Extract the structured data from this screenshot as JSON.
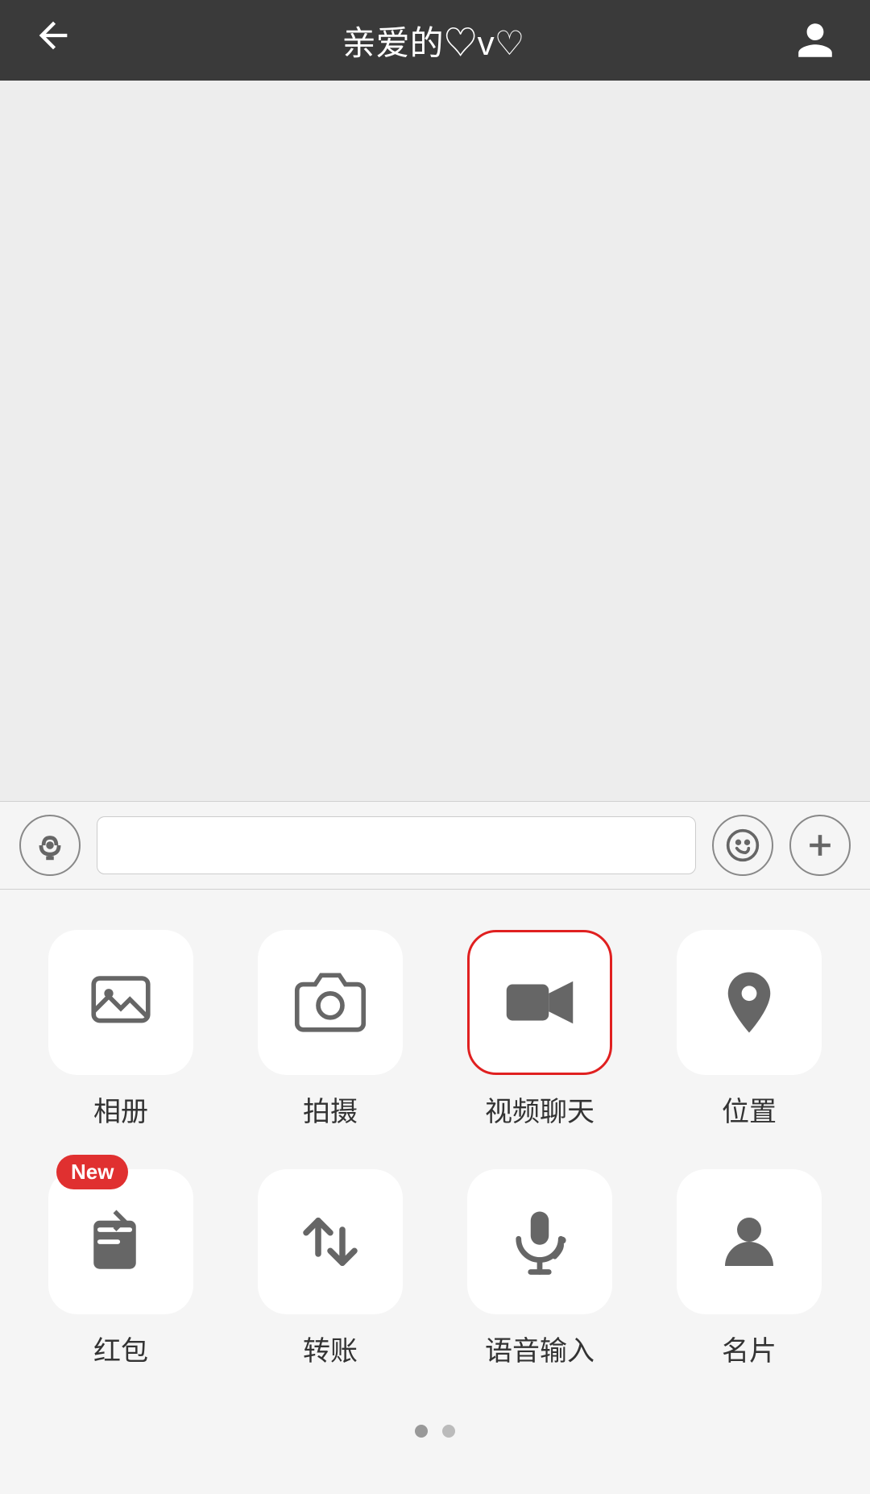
{
  "header": {
    "back_label": "←",
    "title": "亲爱的♡v♡"
  },
  "input_bar": {
    "voice_icon": "voice",
    "emoji_icon": "emoji",
    "plus_icon": "plus"
  },
  "grid": {
    "rows": [
      [
        {
          "id": "album",
          "label": "相册",
          "icon": "image",
          "highlighted": false,
          "new_badge": false
        },
        {
          "id": "camera",
          "label": "拍摄",
          "icon": "camera",
          "highlighted": false,
          "new_badge": false
        },
        {
          "id": "video-chat",
          "label": "视频聊天",
          "icon": "video",
          "highlighted": true,
          "new_badge": false
        },
        {
          "id": "location",
          "label": "位置",
          "icon": "location",
          "highlighted": false,
          "new_badge": false
        }
      ],
      [
        {
          "id": "red-packet",
          "label": "红包",
          "icon": "envelope",
          "highlighted": false,
          "new_badge": true
        },
        {
          "id": "transfer",
          "label": "转账",
          "icon": "transfer",
          "highlighted": false,
          "new_badge": false
        },
        {
          "id": "voice-input",
          "label": "语音输入",
          "icon": "mic",
          "highlighted": false,
          "new_badge": false
        },
        {
          "id": "business-card",
          "label": "名片",
          "icon": "person",
          "highlighted": false,
          "new_badge": false
        }
      ]
    ],
    "new_badge_label": "New"
  },
  "pagination": {
    "dots": [
      true,
      false
    ]
  }
}
